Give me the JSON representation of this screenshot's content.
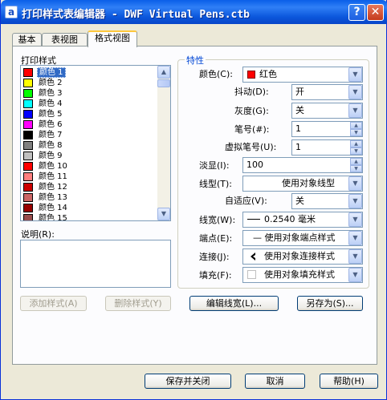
{
  "window": {
    "title": "打印样式表编辑器 - DWF Virtual Pens.ctb",
    "help_glyph": "?",
    "close_glyph": "✕",
    "app_icon_glyph": "a"
  },
  "tabs": [
    {
      "label": "基本",
      "active": false
    },
    {
      "label": "表视图",
      "active": false
    },
    {
      "label": "格式视图",
      "active": true
    }
  ],
  "styles_list": {
    "label": "打印样式",
    "items": [
      {
        "label": "颜色 1",
        "color": "#ff0000",
        "selected": true
      },
      {
        "label": "颜色 2",
        "color": "#ffff00"
      },
      {
        "label": "颜色 3",
        "color": "#00ff00"
      },
      {
        "label": "颜色 4",
        "color": "#00ffff"
      },
      {
        "label": "颜色 5",
        "color": "#0000ff"
      },
      {
        "label": "颜色 6",
        "color": "#ff00ff"
      },
      {
        "label": "颜色 7",
        "color": "#000000"
      },
      {
        "label": "颜色 8",
        "color": "#808080"
      },
      {
        "label": "颜色 9",
        "color": "#c0c0c0"
      },
      {
        "label": "颜色 10",
        "color": "#ff0000"
      },
      {
        "label": "颜色 11",
        "color": "#ff7f7f"
      },
      {
        "label": "颜色 12",
        "color": "#cc0000"
      },
      {
        "label": "颜色 13",
        "color": "#cc6666"
      },
      {
        "label": "颜色 14",
        "color": "#990000"
      },
      {
        "label": "颜色 15",
        "color": "#994c4c"
      }
    ]
  },
  "description": {
    "label": "说明(R):",
    "value": ""
  },
  "buttons": {
    "add_style": "添加样式(A)",
    "delete_style": "删除样式(Y)",
    "edit_lineweights": "编辑线宽(L)...",
    "save_as": "另存为(S)...",
    "save_close": "保存并关闭",
    "cancel": "取消",
    "help": "帮助(H)"
  },
  "properties": {
    "group_title": "特性",
    "color": {
      "label": "颜色(C):",
      "value": "红色"
    },
    "dither": {
      "label": "抖动(D):",
      "value": "开"
    },
    "grayscale": {
      "label": "灰度(G):",
      "value": "关"
    },
    "pen": {
      "label": "笔号(#):",
      "value": "1"
    },
    "virtual_pen": {
      "label": "虚拟笔号(U):",
      "value": "1"
    },
    "screening": {
      "label": "淡显(I):",
      "value": "100"
    },
    "linetype": {
      "label": "线型(T):",
      "value": "使用对象线型"
    },
    "adaptive": {
      "label": "自适应(V):",
      "value": "关"
    },
    "lineweight": {
      "label": "线宽(W):",
      "value": "0.2540 毫米"
    },
    "line_end": {
      "label": "端点(E):",
      "value": "— 使用对象端点样式"
    },
    "line_join": {
      "label": "连接(J):",
      "value": "使用对象连接样式"
    },
    "fill": {
      "label": "填充(F):",
      "value": "使用对象填充样式"
    }
  }
}
